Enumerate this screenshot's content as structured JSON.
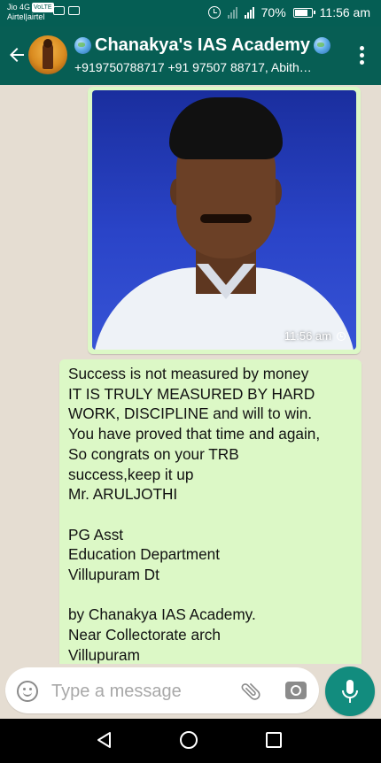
{
  "status_bar": {
    "carrier_line1": "Jio 4G",
    "volte": "VoLTE",
    "carrier_line2": "Airtel|airtel",
    "battery": "70%",
    "time": "11:56 am"
  },
  "header": {
    "title": "Chanakya's IAS Academy",
    "members": "+919750788717 +91 97507 88717, Abith…"
  },
  "messages": {
    "image_time": "11:56 am",
    "text_lines": [
      "Success is not measured by money",
      "IT IS TRULY MEASURED BY HARD",
      "WORK, DISCIPLINE and will to win.",
      "You have proved that time and again,",
      "So congrats on your TRB",
      "success,keep it up",
      "Mr. ARULJOTHI",
      "",
      "PG Asst",
      "Education Department",
      "Villupuram Dt",
      "",
      "by Chanakya IAS Academy.",
      "Near Collectorate arch",
      "Villupuram"
    ]
  },
  "input": {
    "placeholder": "Type a message",
    "value": ""
  },
  "colors": {
    "header_bg": "#075e54",
    "outgoing_bubble": "#dcf8c6",
    "accent": "#128c7e"
  }
}
